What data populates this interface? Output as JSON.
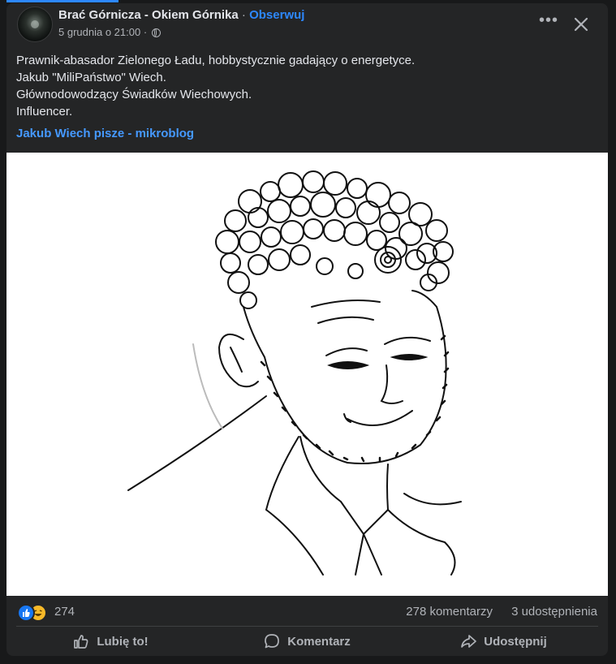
{
  "post": {
    "page_name": "Brać Górnicza - Okiem Górnika",
    "separator": "·",
    "follow_label": "Obserwuj",
    "timestamp": "5 grudnia o 21:00",
    "meta_separator": "·",
    "text_lines": [
      "Prawnik-abasador Zielonego Ładu, hobbystycznie gadający o energetyce.",
      "Jakub \"MiliPaństwo\" Wiech.",
      "Głównodowodzący Świadków Wiechowych.",
      "Influencer."
    ],
    "link_text": "Jakub Wiech pisze - mikroblog",
    "more_icon": "more-horizontal-icon",
    "close_icon": "close-icon"
  },
  "stats": {
    "reaction_count": "274",
    "comments": "278 komentarzy",
    "shares": "3 udostępnienia",
    "reactions": [
      "like",
      "haha"
    ]
  },
  "actions": {
    "like": "Lubię to!",
    "comment": "Komentarz",
    "share": "Udostępnij"
  },
  "colors": {
    "background": "#18191a",
    "card": "#242526",
    "accent": "#2d88ff",
    "link": "#4599ff",
    "text": "#e4e6eb",
    "secondary_text": "#b0b3b8"
  }
}
